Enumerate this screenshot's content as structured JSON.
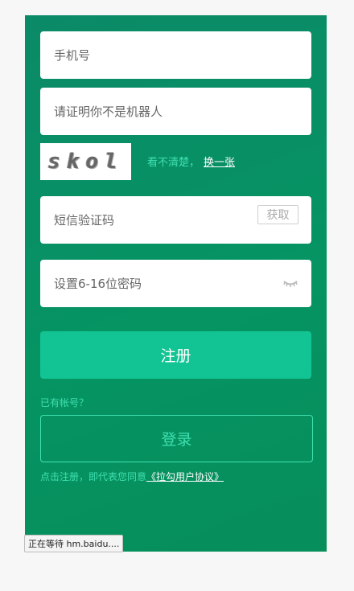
{
  "form": {
    "phone_placeholder": "手机号",
    "captcha_placeholder": "请证明你不是机器人",
    "captcha_text": "skol",
    "captcha_hint": "看不清楚，",
    "captcha_refresh": "换一张",
    "sms_placeholder": "短信验证码",
    "get_code_label": "获取",
    "password_placeholder": "设置6-16位密码",
    "register_label": "注册",
    "have_account": "已有帐号？",
    "login_label": "登录",
    "agree_prefix": "点击注册，即代表您同意",
    "agree_link": "《拉勾用户协议》"
  },
  "status": {
    "text": "正在等待 hm.baidu...."
  },
  "colors": {
    "panel": "#069463",
    "accent": "#3fe0b0",
    "button": "#12c493"
  }
}
